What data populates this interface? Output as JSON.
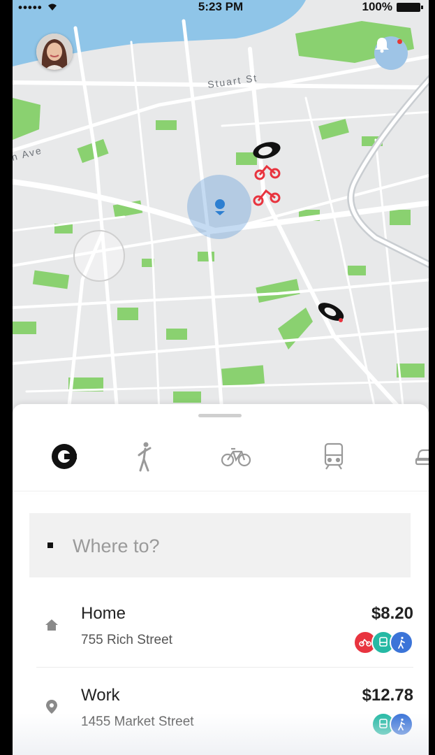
{
  "status_bar": {
    "signal": "•••••",
    "time": "5:23 PM",
    "battery": "100%"
  },
  "map": {
    "street_label_1": "Stuart St",
    "street_label_2": "n Ave"
  },
  "transport_modes": [
    "ride",
    "walk",
    "bike",
    "transit",
    "car"
  ],
  "search": {
    "placeholder": "Where to?"
  },
  "saved_places": [
    {
      "name": "Home",
      "address": "755 Rich Street",
      "price": "$8.20",
      "options": [
        "bike",
        "transit",
        "walk"
      ]
    },
    {
      "name": "Work",
      "address": "1455 Market Street",
      "price": "$12.78",
      "options": [
        "transit",
        "walk"
      ]
    }
  ],
  "colors": {
    "bike": "#e8343f",
    "transit": "#25b9a4",
    "walk": "#3b74d8",
    "park": "#8ad170",
    "location": "#2d7fd1"
  }
}
